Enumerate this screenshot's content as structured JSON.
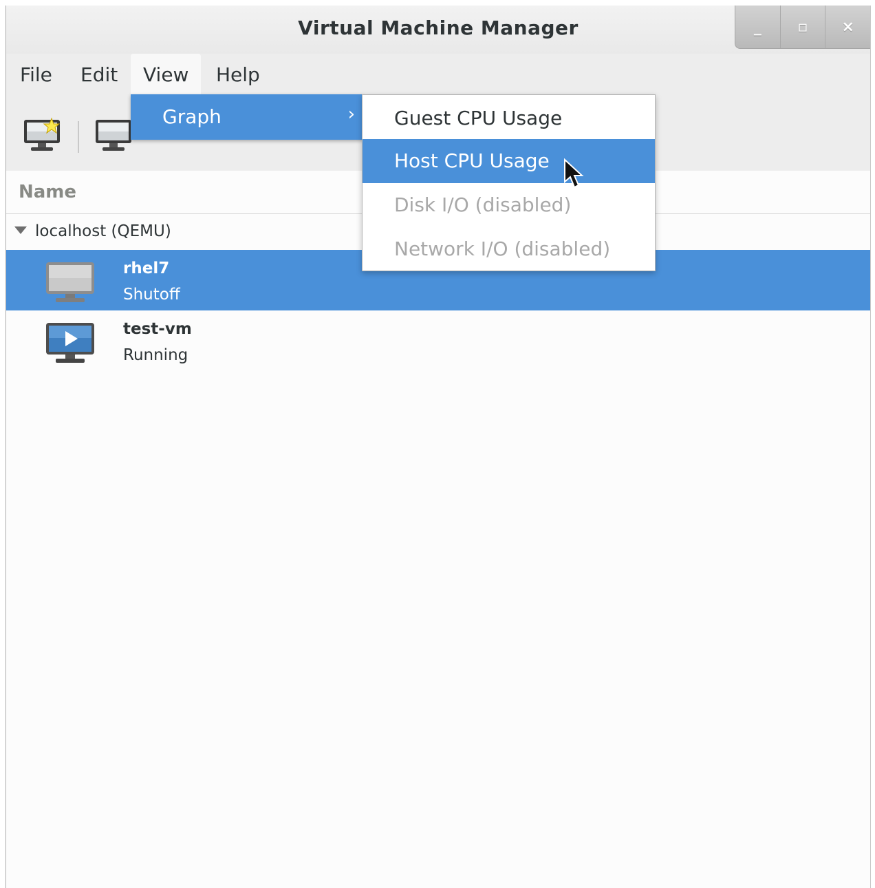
{
  "window": {
    "title": "Virtual Machine Manager",
    "controls": {
      "minimize": "_",
      "maximize": "▫",
      "close": "×"
    }
  },
  "menubar": {
    "items": [
      "File",
      "Edit",
      "View",
      "Help"
    ],
    "open_menu": "View"
  },
  "view_menu": {
    "graph_label": "Graph",
    "graph_arrow": "›"
  },
  "graph_submenu": {
    "items": [
      {
        "label": "Guest CPU Usage",
        "state": "enabled"
      },
      {
        "label": "Host CPU Usage",
        "state": "highlighted"
      },
      {
        "label": "Disk I/O (disabled)",
        "state": "disabled"
      },
      {
        "label": "Network I/O (disabled)",
        "state": "disabled"
      }
    ]
  },
  "list": {
    "column_header": "Name",
    "group": "localhost (QEMU)",
    "vms": [
      {
        "name": "rhel7",
        "status": "Shutoff",
        "selected": true,
        "icon": "monitor-off-icon"
      },
      {
        "name": "test-vm",
        "status": "Running",
        "selected": false,
        "icon": "monitor-running-icon"
      }
    ]
  },
  "colors": {
    "selection": "#4a90d9",
    "background": "#fcfcfc",
    "chrome": "#ededed",
    "disabled_text": "#a8a8a8"
  }
}
